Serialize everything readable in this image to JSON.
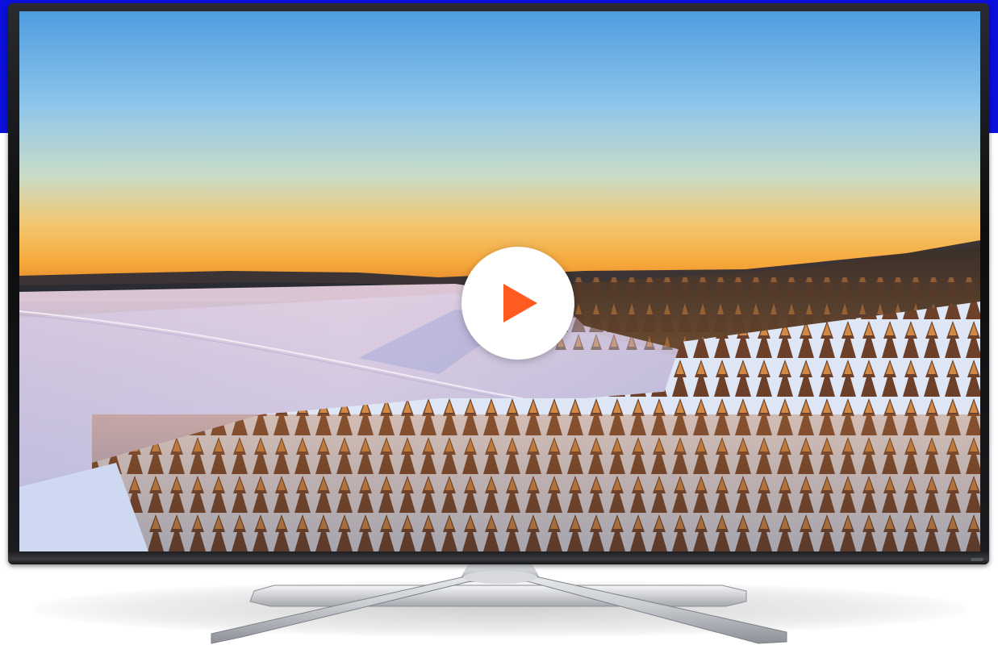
{
  "video_player": {
    "play_icon": "play-icon",
    "accent_color": "#ff5a1f",
    "background_band_color": "#0b10dc"
  }
}
